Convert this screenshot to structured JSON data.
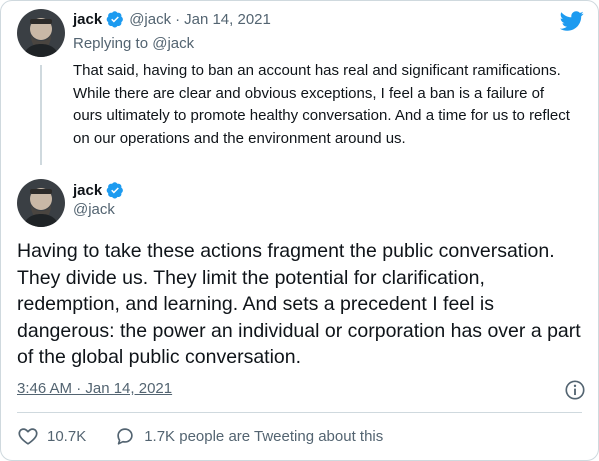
{
  "parent_tweet": {
    "name": "jack",
    "handle": "@jack",
    "separator": "·",
    "date": "Jan 14, 2021",
    "replying_prefix": "Replying to",
    "replying_to": "@jack",
    "text": "That said, having to ban an account has real and significant ramifications. While there are clear and obvious exceptions, I feel a ban is a failure of ours ultimately to promote healthy conversation. And a time for us to reflect on our operations and the environment around us."
  },
  "main_tweet": {
    "name": "jack",
    "handle": "@jack",
    "text": "Having to take these actions fragment the public conversation. They divide us. They limit the potential for clarification, redemption, and learning. And sets a precedent I feel is dangerous: the power an individual or corporation has over a part of the global public conversation.",
    "timestamp": "3:46 AM · Jan 14, 2021",
    "likes": "10.7K",
    "conversation": "1.7K people are Tweeting about this"
  },
  "icons": {
    "logo": "twitter-bird-icon",
    "verified": "verified-badge-icon",
    "info": "info-icon",
    "like": "heart-icon",
    "reply": "speech-bubble-icon"
  },
  "colors": {
    "brand": "#1d9bf0",
    "text": "#0f1419",
    "muted": "#536471",
    "border": "#cfd9de"
  }
}
